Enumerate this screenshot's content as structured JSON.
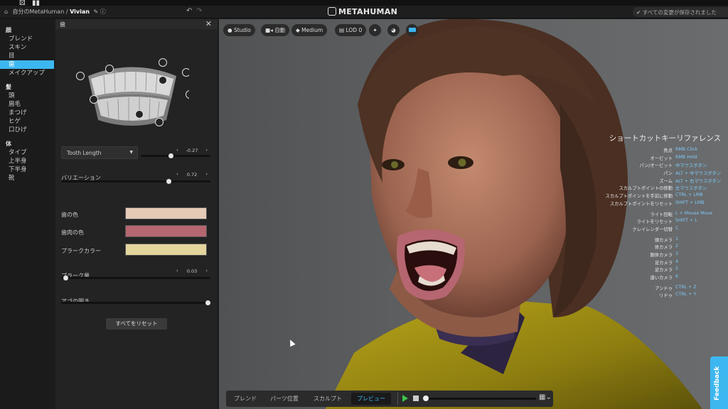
{
  "header": {
    "breadcrumb_root": "自分のMetaHuman",
    "breadcrumb_sep": "/",
    "character_name": "Vivian",
    "logo_text": "METAHUMAN",
    "save_status": "すべての変更が保存されました"
  },
  "nav": {
    "groups": [
      {
        "label": "顔",
        "items": [
          "ブレンド",
          "スキン",
          "目",
          "歯",
          "メイクアップ"
        ]
      },
      {
        "label": "髪",
        "items": [
          "頭",
          "眉毛",
          "まつげ",
          "ヒゲ",
          "口ひげ"
        ]
      },
      {
        "label": "体",
        "items": [
          "タイプ",
          "上半身",
          "下半身",
          "靴"
        ]
      }
    ],
    "selected": "歯"
  },
  "panel": {
    "title": "歯",
    "dropdown_label": "Tooth Length",
    "tooth_length_value": "-0.27",
    "tooth_length_level": 0.43,
    "variation_label": "バリエーション",
    "variation_value": "0.72",
    "variation_level": 0.72,
    "tooth_color_label": "歯の色",
    "tooth_color": "#e6cbb7",
    "gum_color_label": "歯肉の色",
    "gum_color": "#b66670",
    "plaque_color_label": "プラークカラー",
    "plaque_color": "#e3d59c",
    "plaque_amount_label": "プラーク量",
    "plaque_amount_value": "0.03",
    "plaque_amount_level": 0.03,
    "jaw_open_label": "アゴの開き",
    "jaw_open_level": 1.0,
    "reset_label": "すべてをリセット"
  },
  "toolbar": {
    "studio": "Studio",
    "auto": "自動",
    "quality": "Medium",
    "lod": "LOD 0"
  },
  "shortcuts": {
    "title": "ショートカットキーリファレンス",
    "groups": [
      [
        {
          "k": "焦点",
          "v": "RMB Click"
        },
        {
          "k": "オービット",
          "v": "RMB Hold"
        },
        {
          "k": "パン/オービット",
          "v": "中マウスボタン"
        },
        {
          "k": "パン",
          "v": "ALT + 中マウスボタン"
        },
        {
          "k": "ズーム",
          "v": "ALT + 右マウスボタン"
        },
        {
          "k": "スカルプトポイントの移動",
          "v": "左マウスボタン"
        },
        {
          "k": "スカルプトポイントを手前に移動",
          "v": "CTRL + LMB"
        },
        {
          "k": "スカルプトポイントをリセット",
          "v": "SHIFT + LMB"
        }
      ],
      [
        {
          "k": "ライト回転",
          "v": "L + Mouse Move"
        },
        {
          "k": "ライトをリセット",
          "v": "SHIFT + L"
        },
        {
          "k": "クレイレンダー切替",
          "v": "C"
        }
      ],
      [
        {
          "k": "頭カメラ",
          "v": "1"
        },
        {
          "k": "体カメラ",
          "v": "2"
        },
        {
          "k": "胴体カメラ",
          "v": "3"
        },
        {
          "k": "足カメラ",
          "v": "4"
        },
        {
          "k": "足カメラ",
          "v": "5"
        },
        {
          "k": "遠いカメラ",
          "v": "6"
        }
      ],
      [
        {
          "k": "アンドゥ",
          "v": "CTRL + Z"
        },
        {
          "k": "リドゥ",
          "v": "CTRL + Y"
        }
      ]
    ]
  },
  "bottom_tabs": [
    "ブレンド",
    "パーツ位置",
    "スカルプト",
    "プレビュー"
  ],
  "bottom_selected": "プレビュー",
  "feedback_label": "Feedback",
  "colors": {
    "accent": "#3db7f0",
    "play": "#3ec24a"
  }
}
